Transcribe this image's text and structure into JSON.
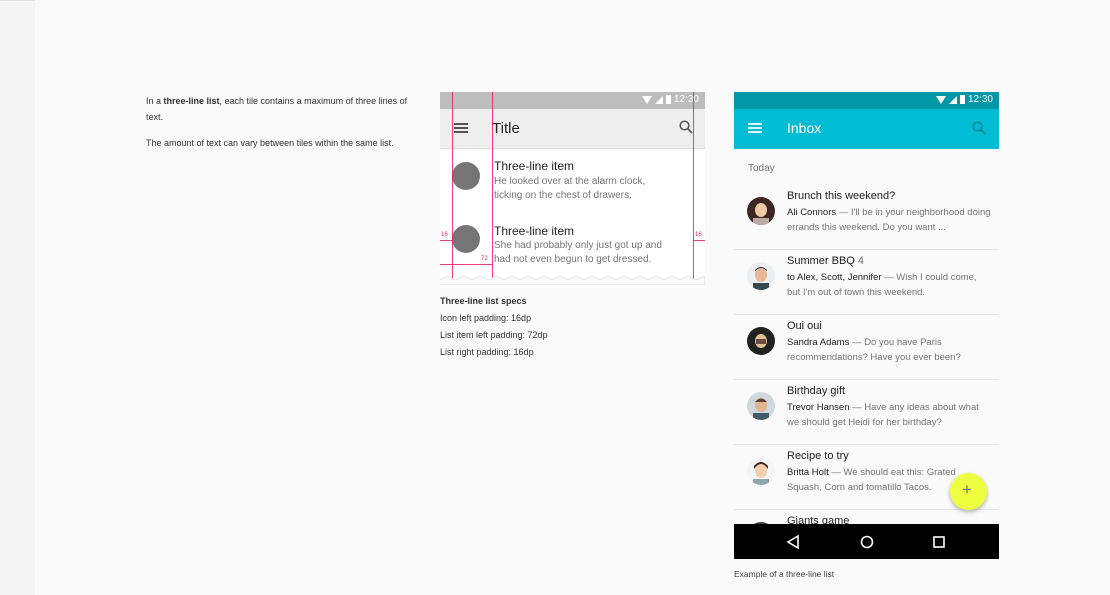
{
  "description": {
    "p1_prefix": "In a ",
    "p1_bold": "three-line list",
    "p1_suffix": ", each tile contains a maximum of three lines of text.",
    "p2": "The amount of text can vary between tiles within the same list."
  },
  "spec_phone": {
    "time": "12:30",
    "title": "Title",
    "items": [
      {
        "title": "Three-line item",
        "line1": "He looked over at the alarm clock,",
        "line2": "ticking on the chest of drawers."
      },
      {
        "title": "Three-line item",
        "line1": "She had probably only just got up and",
        "line2": "had not even begun to get dressed."
      }
    ],
    "labels": {
      "left": "16",
      "item": "72",
      "right": "16"
    }
  },
  "spec_caption": {
    "heading": "Three-line list specs",
    "lines": [
      "Icon left padding: 16dp",
      "List item left padding: 72dp",
      "List right padding: 16dp"
    ]
  },
  "inbox_phone": {
    "time": "12:30",
    "title": "Inbox",
    "section": "Today",
    "accent": "#00bcd4",
    "status_color": "#0097a7",
    "fab_color": "#eeff41",
    "fab_icon": "+",
    "mails": [
      {
        "subject": "Brunch this weekend?",
        "count": "",
        "sender": "Ali Connors",
        "text": " — I'll be in your neighborhood doing errands this weekend. Do you want ..."
      },
      {
        "subject": "Summer BBQ",
        "count": "4",
        "sender": "to Alex, Scott, Jennifer",
        "text": " — Wish I could come, but I'm out of town this weekend."
      },
      {
        "subject": "Oui oui",
        "count": "",
        "sender": "Sandra Adams",
        "text": " — Do you have Paris recommendations? Have you ever been?"
      },
      {
        "subject": "Birthday gift",
        "count": "",
        "sender": "Trevor Hansen",
        "text": " — Have any ideas about what we should get Heidi for her birthday?"
      },
      {
        "subject": "Recipe to try",
        "count": "",
        "sender": "Britta Holt",
        "text": " — We should eat this: Grated Squash, Corn and tomatillo Tacos."
      },
      {
        "subject": "Giants game",
        "count": "",
        "sender": "",
        "text": ""
      }
    ]
  },
  "phone_caption": "Example of a three-line list"
}
